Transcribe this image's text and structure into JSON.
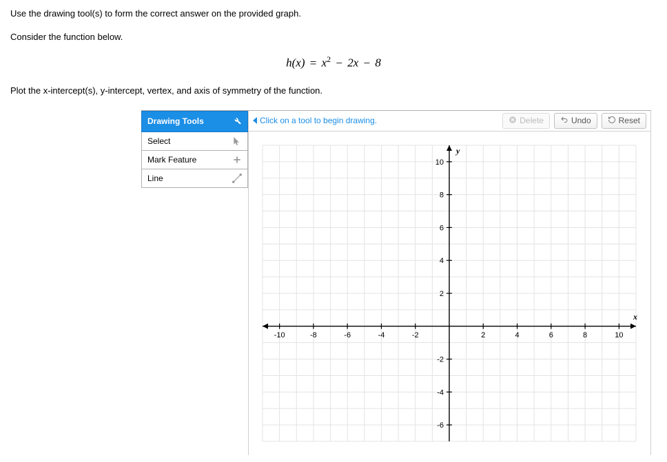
{
  "instructions": {
    "line1": "Use the drawing tool(s) to form the correct answer on the provided graph.",
    "line2": "Consider the function below.",
    "line3": "Plot the x-intercept(s), y-intercept, vertex, and axis of symmetry of the function."
  },
  "equation": {
    "fn": "h",
    "var": "x",
    "body_html": "x² − 2x − 8"
  },
  "drawing_tools": {
    "header": "Drawing Tools",
    "items": [
      {
        "label": "Select",
        "icon": "select"
      },
      {
        "label": "Mark Feature",
        "icon": "plus"
      },
      {
        "label": "Line",
        "icon": "line"
      }
    ]
  },
  "graph_toolbar": {
    "hint": "Click on a tool to begin drawing.",
    "delete": "Delete",
    "undo": "Undo",
    "reset": "Reset"
  },
  "chart_data": {
    "type": "scatter",
    "title": "",
    "xlabel": "x",
    "ylabel": "y",
    "xlim": [
      -11,
      11
    ],
    "ylim": [
      -11,
      11
    ],
    "xticks": [
      -10,
      -8,
      -6,
      -4,
      -2,
      2,
      4,
      6,
      8,
      10
    ],
    "yticks": [
      -6,
      -4,
      -2,
      2,
      4,
      6,
      8,
      10
    ],
    "grid": true,
    "series": []
  }
}
